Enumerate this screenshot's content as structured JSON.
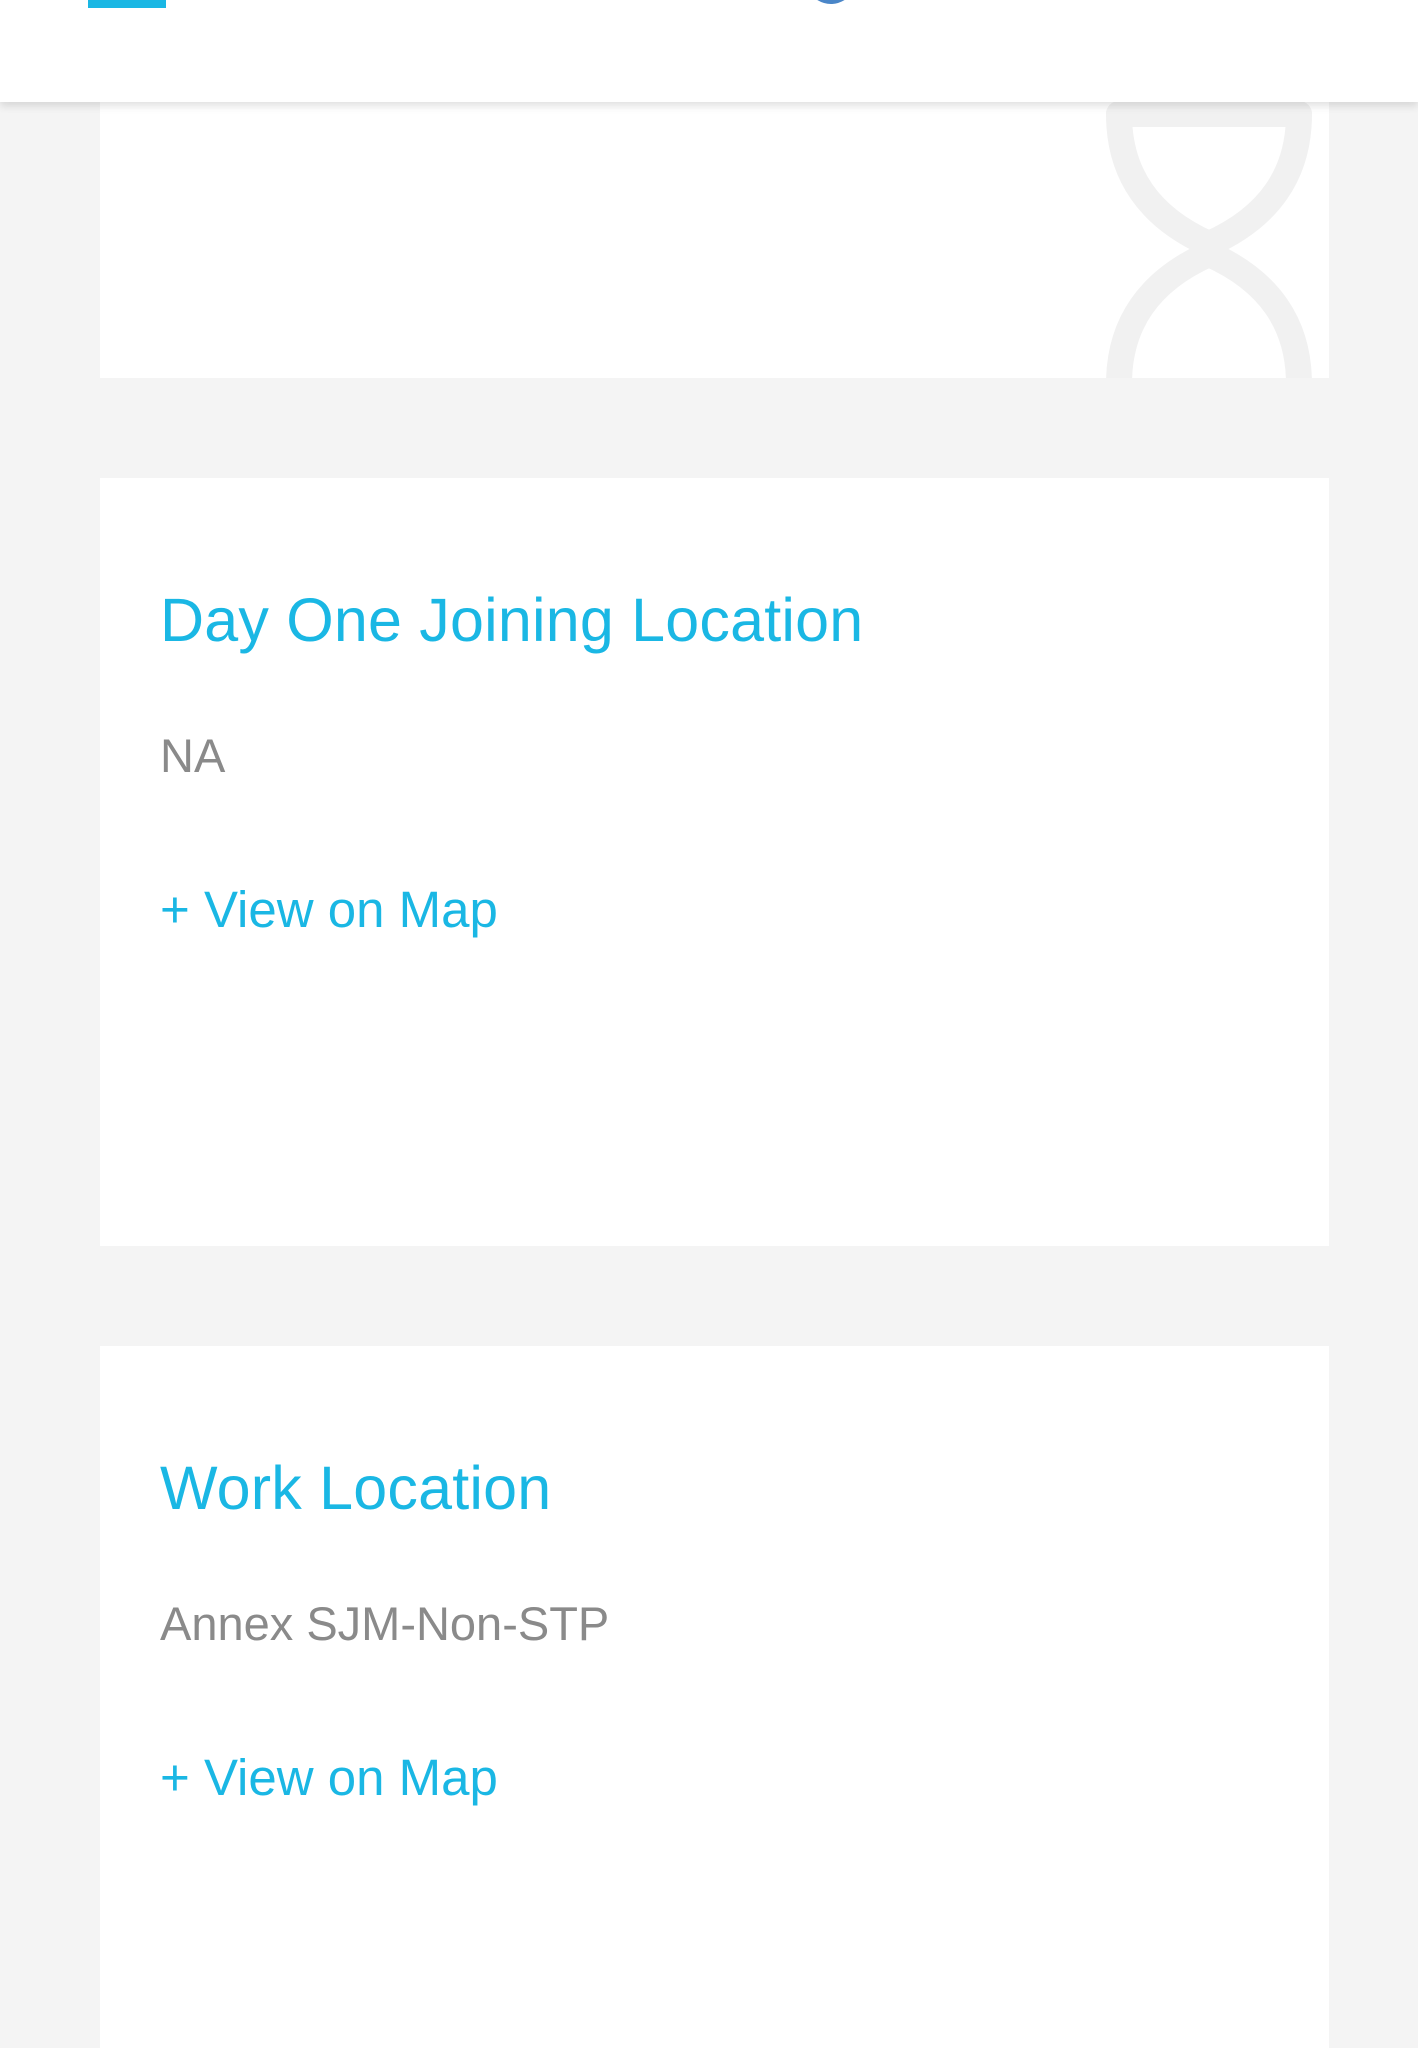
{
  "header": {
    "menu_icon": "menu-icon",
    "accent_color": "#1ab7e4"
  },
  "top_card": {
    "watermark_icon": "hourglass-icon"
  },
  "cards": [
    {
      "title": "Day One Joining Location",
      "value": "NA",
      "link": "+ View on Map"
    },
    {
      "title": "Work Location",
      "value": "Annex SJM-Non-STP",
      "link": "+ View on Map"
    }
  ],
  "colors": {
    "title": "#1ab7e4",
    "value": "#8a8a8a",
    "background": "#f4f4f4",
    "card": "#ffffff"
  }
}
